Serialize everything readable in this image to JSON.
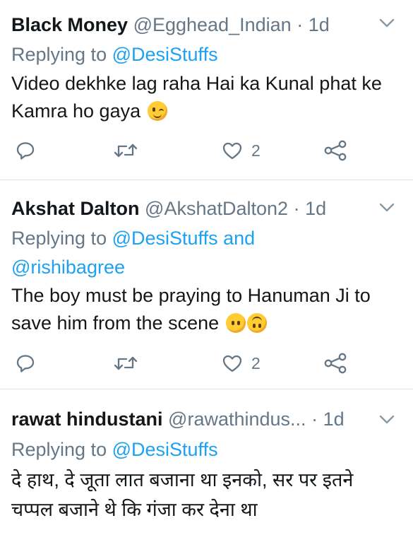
{
  "tweets": [
    {
      "name": "Black Money",
      "handle": "@Egghead_Indian",
      "dot": "·",
      "time": "1d",
      "replying_prefix": "Replying to",
      "replying_to": "@DesiStuffs",
      "replying_and": "",
      "replying_to_2": "",
      "text": "Video dekhke lag raha Hai ka Kunal phat ke Kamra ho gaya",
      "like_count": "2"
    },
    {
      "name": "Akshat Dalton",
      "handle": "@AkshatDalton2",
      "dot": "·",
      "time": "1d",
      "replying_prefix": "Replying to",
      "replying_to": "@DesiStuffs",
      "replying_and": "and",
      "replying_to_2": "@rishibagree",
      "text": "The boy must be praying to Hanuman Ji to save him from the scene",
      "like_count": "2"
    },
    {
      "name": "rawat hindustani",
      "handle": "@rawathindus...",
      "dot": "·",
      "time": "1d",
      "replying_prefix": "Replying to",
      "replying_to": "@DesiStuffs",
      "replying_and": "",
      "replying_to_2": "",
      "text": "दे हाथ, दे जूता लात बजाना था इनको, सर पर इतने चप्पल बजाने थे कि गंजा कर देना था"
    }
  ],
  "colors": {
    "text": "#14171a",
    "secondary": "#657786",
    "link": "#1da1f2",
    "divider": "#dfe3e7"
  },
  "icons": {
    "reply": "reply-icon",
    "retweet": "retweet-icon",
    "like": "heart-icon",
    "share": "share-icon",
    "more": "chevron-down-icon",
    "emoji_1": "winking-face-emoji",
    "emoji_2": "face-without-mouth-emoji",
    "emoji_3": "upside-down-face-emoji"
  }
}
